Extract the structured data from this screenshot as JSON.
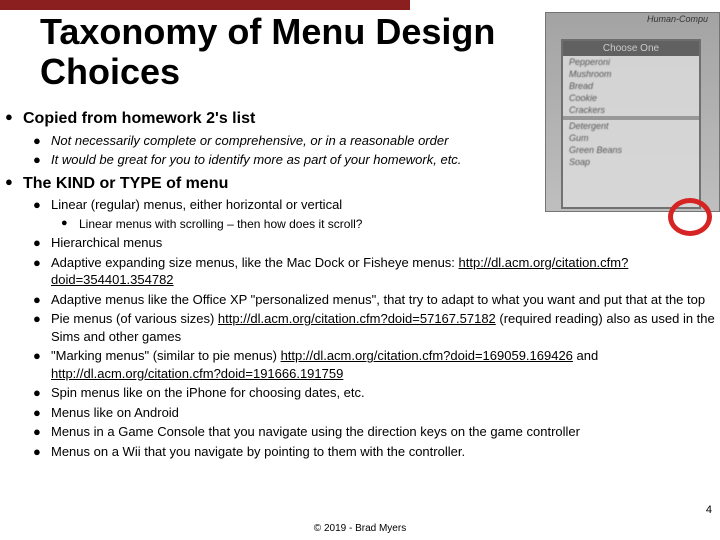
{
  "title": "Taxonomy of Menu Design Choices",
  "bg_label": "Human-Compu",
  "bg_menu_header": "Choose One",
  "sections": {
    "s1": {
      "heading": "Copied from homework 2's list",
      "b1": "Not necessarily complete or comprehensive, or in a reasonable order",
      "b2": "It would be great for you to identify more as part of your homework, etc."
    },
    "s2": {
      "heading": "The KIND or TYPE of menu",
      "linear": "Linear (regular) menus, either horizontal or vertical",
      "linear_sub": "Linear menus with scrolling – then how does it scroll?",
      "hier": "Hierarchical menus",
      "adapt_pre": "Adaptive expanding size menus, like the Mac Dock or Fisheye menus: ",
      "adapt_link": "http://dl.acm.org/citation.cfm?doid=354401.354782",
      "adapt2": "Adaptive menus like the Office XP \"personalized menus\", that try to adapt to what you want and put that at the top",
      "pie_pre": "Pie menus (of various sizes) ",
      "pie_link": "http://dl.acm.org/citation.cfm?doid=57167.57182",
      "pie_post": " (required reading) also as used in the Sims and other games",
      "marking_pre": "\"Marking menus\" (similar to pie menus) ",
      "marking_link1": "http://dl.acm.org/citation.cfm?doid=169059.169426",
      "marking_and": " and ",
      "marking_link2": "http://dl.acm.org/citation.cfm?doid=191666.191759",
      "spin": "Spin menus like on the iPhone for choosing dates, etc.",
      "android": "Menus like on Android",
      "console": "Menus in a Game Console that you navigate using the direction keys on the game controller",
      "wii": "Menus on a Wii that you navigate by pointing to them with the controller."
    }
  },
  "page_number": "4",
  "footer": "© 2019 - Brad Myers"
}
